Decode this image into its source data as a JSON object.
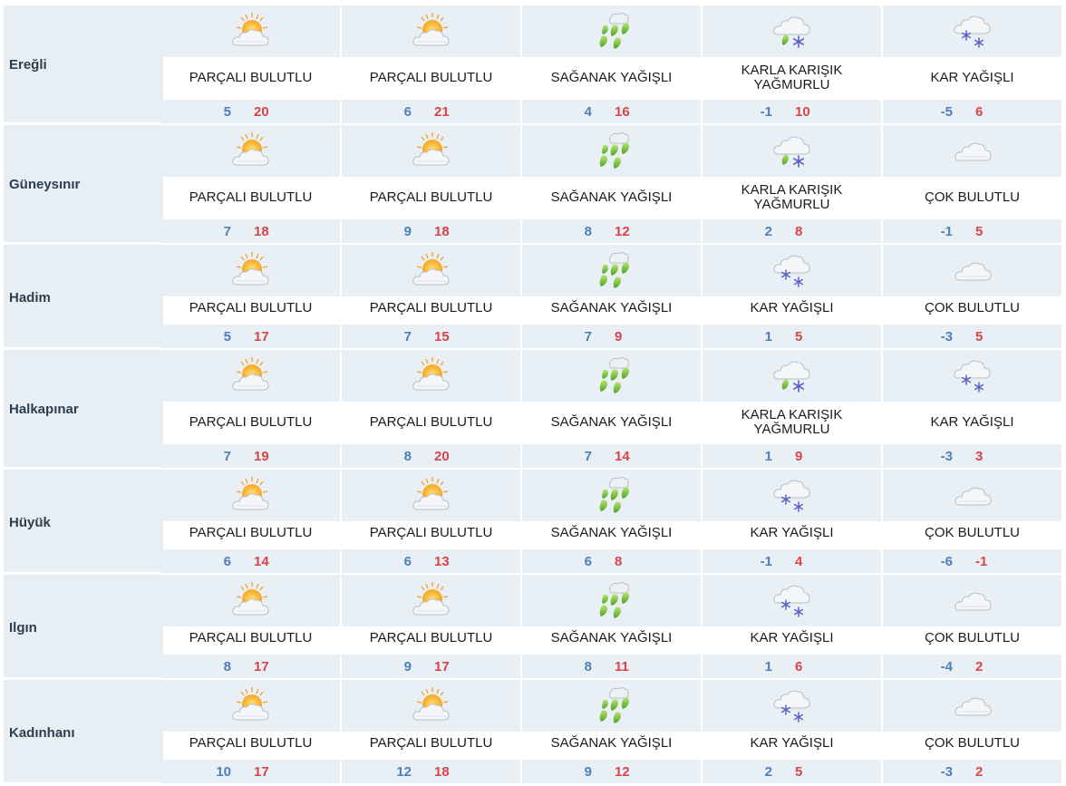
{
  "labels": {
    "pb": "PARÇALI BULUTLU",
    "sy": "SAĞANAK YAĞIŞLI",
    "kky1": "KARLA KARIŞIK",
    "kky2": "YAĞMURLU",
    "ky": "KAR YAĞIŞLI",
    "cb": "ÇOK BULUTLU"
  },
  "colors": {
    "min": "#4d7fb8",
    "max": "#d9444b",
    "band": "#e9f0f5"
  },
  "rows": [
    {
      "city": "Ereğli",
      "days": [
        {
          "icon": "partly-cloudy-icon",
          "cond": "PARÇALI BULUTLU",
          "min": "5",
          "max": "20"
        },
        {
          "icon": "partly-cloudy-icon",
          "cond": "PARÇALI BULUTLU",
          "min": "6",
          "max": "21"
        },
        {
          "icon": "showers-icon",
          "cond": "SAĞANAK YAĞIŞLI",
          "min": "4",
          "max": "16"
        },
        {
          "icon": "sleet-icon",
          "cond": "KARLA KARIŞIK YAĞMURLU",
          "cond1": "KARLA KARIŞIK",
          "cond2": "YAĞMURLU",
          "min": "-1",
          "max": "10"
        },
        {
          "icon": "snow-icon",
          "cond": "KAR YAĞIŞLI",
          "min": "-5",
          "max": "6"
        }
      ]
    },
    {
      "city": "Güneysınır",
      "days": [
        {
          "icon": "partly-cloudy-icon",
          "cond": "PARÇALI BULUTLU",
          "min": "7",
          "max": "18"
        },
        {
          "icon": "partly-cloudy-icon",
          "cond": "PARÇALI BULUTLU",
          "min": "9",
          "max": "18"
        },
        {
          "icon": "showers-icon",
          "cond": "SAĞANAK YAĞIŞLI",
          "min": "8",
          "max": "12"
        },
        {
          "icon": "sleet-icon",
          "cond": "KARLA KARIŞIK YAĞMURLU",
          "cond1": "KARLA KARIŞIK",
          "cond2": "YAĞMURLU",
          "min": "2",
          "max": "8"
        },
        {
          "icon": "cloudy-icon",
          "cond": "ÇOK BULUTLU",
          "min": "-1",
          "max": "5"
        }
      ]
    },
    {
      "city": "Hadim",
      "days": [
        {
          "icon": "partly-cloudy-icon",
          "cond": "PARÇALI BULUTLU",
          "min": "5",
          "max": "17"
        },
        {
          "icon": "partly-cloudy-icon",
          "cond": "PARÇALI BULUTLU",
          "min": "7",
          "max": "15"
        },
        {
          "icon": "showers-icon",
          "cond": "SAĞANAK YAĞIŞLI",
          "min": "7",
          "max": "9"
        },
        {
          "icon": "snow-icon",
          "cond": "KAR YAĞIŞLI",
          "min": "1",
          "max": "5"
        },
        {
          "icon": "cloudy-icon",
          "cond": "ÇOK BULUTLU",
          "min": "-3",
          "max": "5"
        }
      ]
    },
    {
      "city": "Halkapınar",
      "days": [
        {
          "icon": "partly-cloudy-icon",
          "cond": "PARÇALI BULUTLU",
          "min": "7",
          "max": "19"
        },
        {
          "icon": "partly-cloudy-icon",
          "cond": "PARÇALI BULUTLU",
          "min": "8",
          "max": "20"
        },
        {
          "icon": "showers-icon",
          "cond": "SAĞANAK YAĞIŞLI",
          "min": "7",
          "max": "14"
        },
        {
          "icon": "sleet-icon",
          "cond": "KARLA KARIŞIK YAĞMURLU",
          "cond1": "KARLA KARIŞIK",
          "cond2": "YAĞMURLU",
          "min": "1",
          "max": "9"
        },
        {
          "icon": "snow-icon",
          "cond": "KAR YAĞIŞLI",
          "min": "-3",
          "max": "3"
        }
      ]
    },
    {
      "city": "Hüyük",
      "days": [
        {
          "icon": "partly-cloudy-icon",
          "cond": "PARÇALI BULUTLU",
          "min": "6",
          "max": "14"
        },
        {
          "icon": "partly-cloudy-icon",
          "cond": "PARÇALI BULUTLU",
          "min": "6",
          "max": "13"
        },
        {
          "icon": "showers-icon",
          "cond": "SAĞANAK YAĞIŞLI",
          "min": "6",
          "max": "8"
        },
        {
          "icon": "snow-icon",
          "cond": "KAR YAĞIŞLI",
          "min": "-1",
          "max": "4"
        },
        {
          "icon": "cloudy-icon",
          "cond": "ÇOK BULUTLU",
          "min": "-6",
          "max": "-1"
        }
      ]
    },
    {
      "city": "Ilgın",
      "days": [
        {
          "icon": "partly-cloudy-icon",
          "cond": "PARÇALI BULUTLU",
          "min": "8",
          "max": "17"
        },
        {
          "icon": "partly-cloudy-icon",
          "cond": "PARÇALI BULUTLU",
          "min": "9",
          "max": "17"
        },
        {
          "icon": "showers-icon",
          "cond": "SAĞANAK YAĞIŞLI",
          "min": "8",
          "max": "11"
        },
        {
          "icon": "snow-icon",
          "cond": "KAR YAĞIŞLI",
          "min": "1",
          "max": "6"
        },
        {
          "icon": "cloudy-icon",
          "cond": "ÇOK BULUTLU",
          "min": "-4",
          "max": "2"
        }
      ]
    },
    {
      "city": "Kadınhanı",
      "days": [
        {
          "icon": "partly-cloudy-icon",
          "cond": "PARÇALI BULUTLU",
          "min": "10",
          "max": "17"
        },
        {
          "icon": "partly-cloudy-icon",
          "cond": "PARÇALI BULUTLU",
          "min": "12",
          "max": "18"
        },
        {
          "icon": "showers-icon",
          "cond": "SAĞANAK YAĞIŞLI",
          "min": "9",
          "max": "12"
        },
        {
          "icon": "snow-icon",
          "cond": "KAR YAĞIŞLI",
          "min": "2",
          "max": "5"
        },
        {
          "icon": "cloudy-icon",
          "cond": "ÇOK BULUTLU",
          "min": "-3",
          "max": "2"
        }
      ]
    }
  ]
}
